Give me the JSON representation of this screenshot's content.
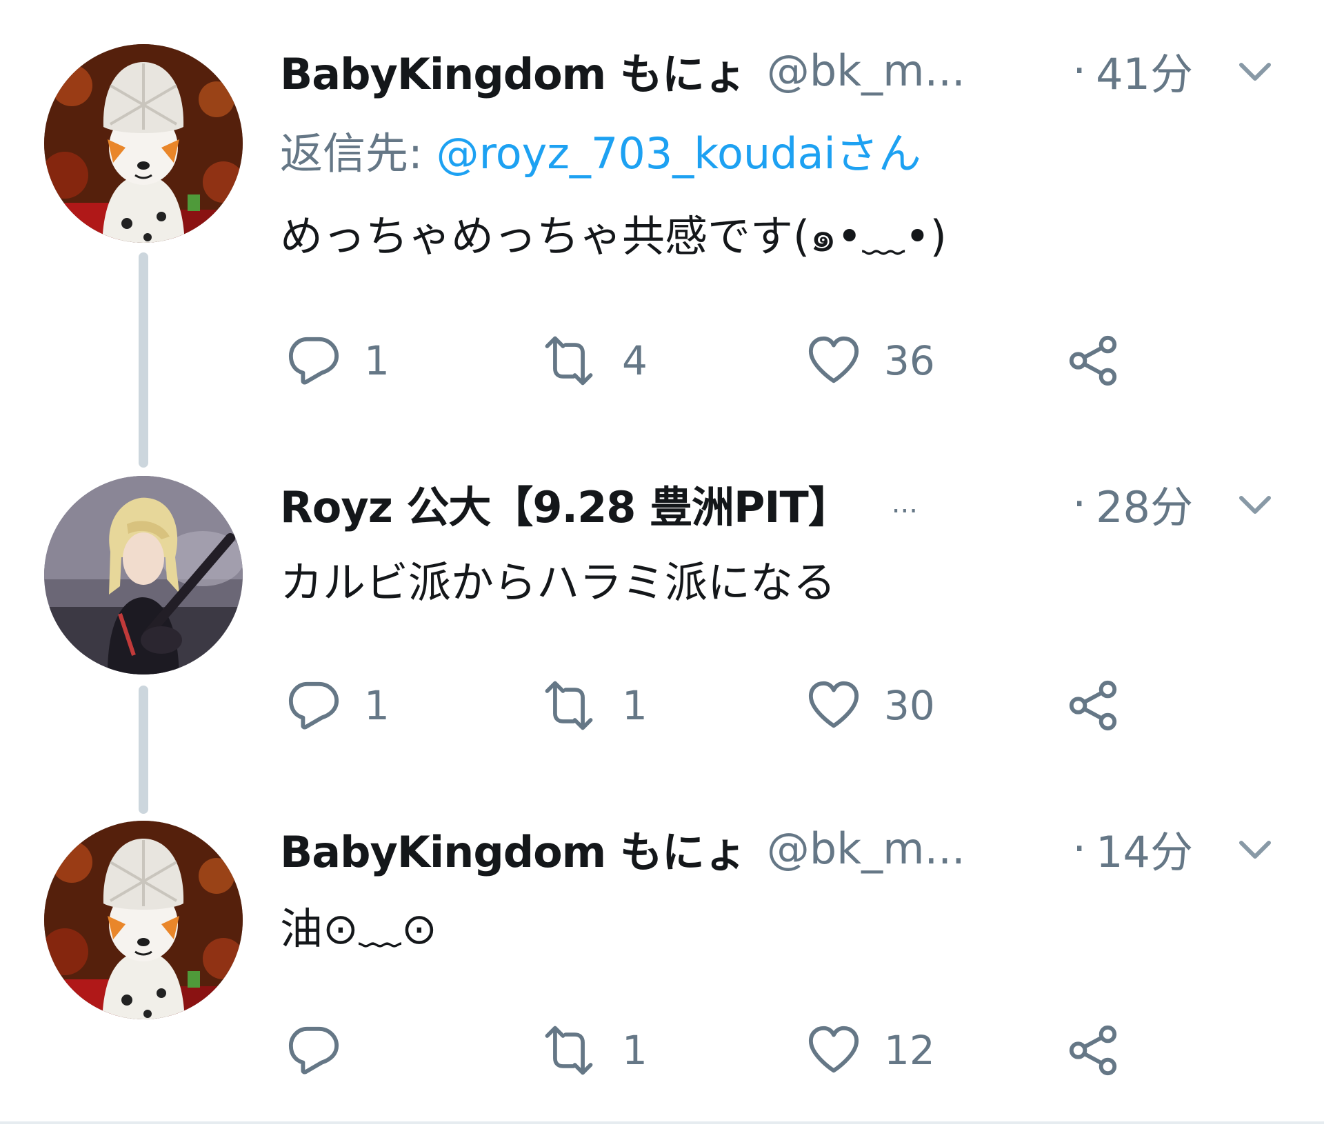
{
  "colors": {
    "text_primary": "#14171a",
    "text_secondary": "#657786",
    "link": "#1da1f2",
    "thread_line": "#ccd6dd"
  },
  "tweets": [
    {
      "display_name": "BabyKingdom もにょ",
      "handle": "@bk_m...",
      "time": "41分",
      "reply_label": "返信先: ",
      "reply_mention": "@royz_703_koudaiさん",
      "text": "めっちゃめっちゃ共感です(๑•﹏•)",
      "replies": "1",
      "retweets": "4",
      "likes": "36",
      "avatar": "costume-avatar"
    },
    {
      "display_name": "Royz 公大【9.28 豊洲PIT】",
      "handle": "...",
      "time": "28分",
      "text": "カルビ派からハラミ派になる",
      "replies": "1",
      "retweets": "1",
      "likes": "30",
      "avatar": "guitarist-avatar"
    },
    {
      "display_name": "BabyKingdom もにょ",
      "handle": "@bk_m...",
      "time": "14分",
      "text": "油⊙﹏⊙",
      "replies": "",
      "retweets": "1",
      "likes": "12",
      "avatar": "costume-avatar"
    }
  ],
  "separator": "·",
  "icons": [
    "reply-icon",
    "retweet-icon",
    "like-icon",
    "share-icon",
    "chevron-down-icon"
  ]
}
